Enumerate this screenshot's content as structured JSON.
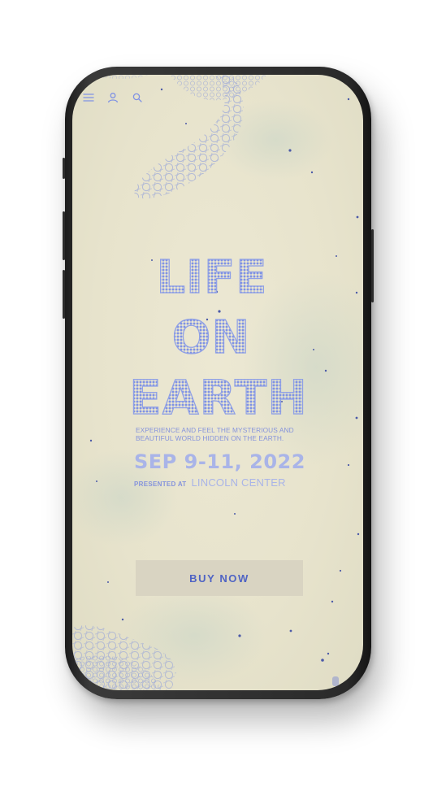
{
  "nav": {
    "menu_icon": "menu-icon",
    "account_icon": "user-icon",
    "search_icon": "search-icon"
  },
  "hero": {
    "title_line1": "LIFE",
    "title_line2": "ON",
    "title_line3": "EARTH",
    "tagline": "EXPERIENCE AND FEEL THE MYSTERIOUS AND BEAUTIFUL WORLD HIDDEN ON THE EARTH.",
    "dates": "SEP 9-11, 2022",
    "presented_prefix": "PRESENTED AT",
    "venue": "LINCOLN CENTER"
  },
  "cta": {
    "buy_label": "BUY NOW"
  },
  "colors": {
    "background": "#e9e5cf",
    "accent_blue": "#7f92e4",
    "button_bg": "#d9d4c2",
    "button_text": "#4f63c4"
  }
}
